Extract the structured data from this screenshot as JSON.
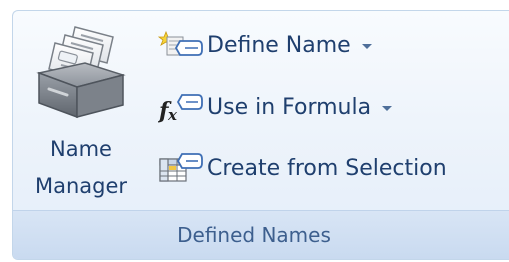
{
  "group": {
    "title": "Defined Names"
  },
  "name_manager": {
    "label_line1": "Name",
    "label_line2": "Manager",
    "icon": "card-file-box-icon"
  },
  "commands": {
    "define_name": {
      "label": "Define Name",
      "icon": "tag-star-icon",
      "has_dropdown": true
    },
    "use_in_formula": {
      "label": "Use in Formula",
      "icon": "fx-tag-icon",
      "has_dropdown": true
    },
    "create_from_selection": {
      "label": "Create from Selection",
      "icon": "table-tag-icon",
      "has_dropdown": false
    }
  },
  "colors": {
    "text": "#1f3f6e",
    "footer_text": "#3d5f8e",
    "group_border": "#c3d6ea"
  }
}
